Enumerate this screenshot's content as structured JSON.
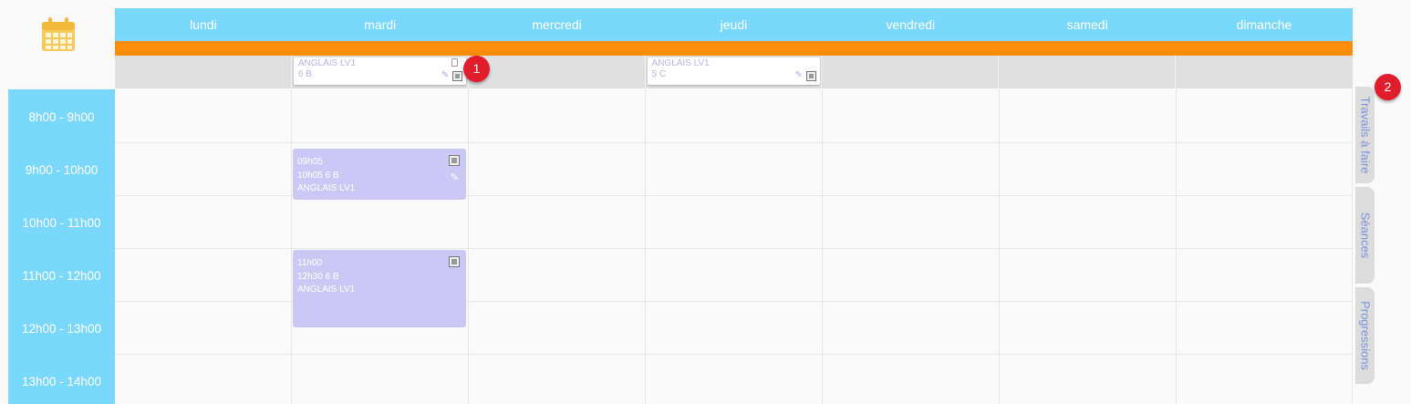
{
  "calendar_icon": "calendar-icon",
  "days": [
    "lundi",
    "mardi",
    "mercredi",
    "jeudi",
    "vendredi",
    "samedi",
    "dimanche"
  ],
  "time_slots": [
    "8h00 - 9h00",
    "9h00 - 10h00",
    "10h00 - 11h00",
    "11h00 - 12h00",
    "12h00 - 13h00",
    "13h00 - 14h00"
  ],
  "allday_cards": [
    {
      "day": "mardi",
      "subject": "ANGLAIS LV1",
      "class": "6 B"
    },
    {
      "day": "jeudi",
      "subject": "ANGLAIS LV1",
      "class": "5 C"
    }
  ],
  "events": [
    {
      "day": "mardi",
      "start": "09h05",
      "end_class": "10h05  6 B",
      "subject": "ANGLAIS LV1"
    },
    {
      "day": "mardi",
      "start": "11h00",
      "end_class": "12h30  6 B",
      "subject": "ANGLAIS LV1"
    }
  ],
  "badges": [
    "1",
    "2"
  ],
  "side_tabs": [
    "Travails à faire",
    "Séances",
    "Progressions"
  ],
  "colors": {
    "header": "#7ad8fc",
    "orange_bar": "#ff8c0a",
    "event": "#cbc8f5",
    "badge": "#e01e2b",
    "tab_text": "#7b93db"
  }
}
